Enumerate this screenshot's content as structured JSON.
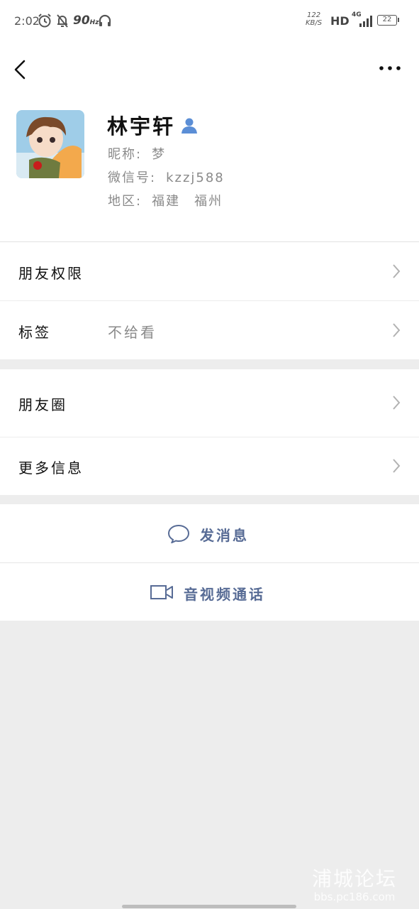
{
  "status_bar": {
    "time": "2:02",
    "refresh_rate": "90",
    "refresh_unit": "Hz",
    "net_speed_value": "122",
    "net_speed_unit": "KB/S",
    "hd": "HD",
    "network": "4G",
    "battery": "22"
  },
  "profile": {
    "name": "林宇轩",
    "nickname_label": "昵称:",
    "nickname_value": "梦",
    "wechat_id_label": "微信号:",
    "wechat_id_value": "kzzj588",
    "region_label": "地区:",
    "region_value": "福建　福州"
  },
  "menu": {
    "friend_permissions": "朋友权限",
    "tags_label": "标签",
    "tags_value": "不给看",
    "moments": "朋友圈",
    "more_info": "更多信息"
  },
  "actions": {
    "send_message": "发消息",
    "voice_video_call": "音视频通话"
  },
  "watermark": {
    "line1": "浦城论坛",
    "line2": "bbs.pc186.com"
  },
  "colors": {
    "accent_link": "#576b95",
    "contact_icon": "#5b8ed6",
    "background": "#ededed"
  }
}
